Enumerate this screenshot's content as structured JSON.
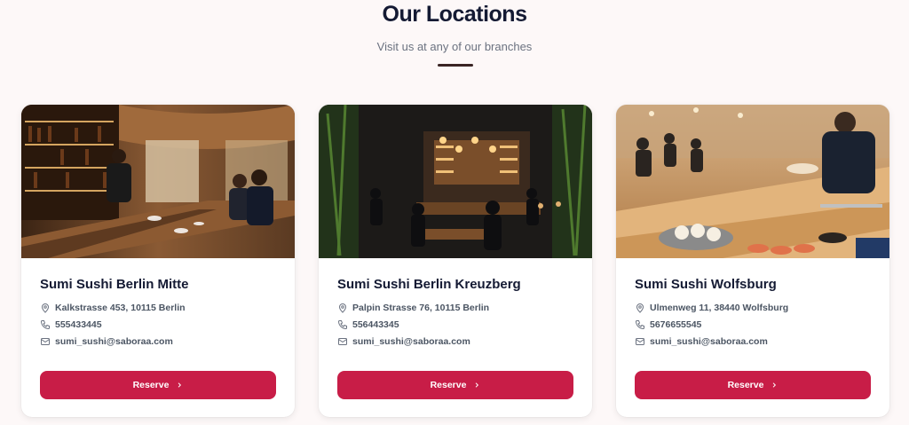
{
  "header": {
    "title": "Our Locations",
    "subtitle": "Visit us at any of our branches"
  },
  "colors": {
    "accent": "#c81d47",
    "title": "#141a33",
    "divider": "#3a2424",
    "background": "#fdf8f8"
  },
  "locations": [
    {
      "name": "Sumi Sushi Berlin Mitte",
      "address": "Kalkstrasse 453, 10115 Berlin",
      "phone": "555433445",
      "email": "sumi_sushi@saboraa.com",
      "button": "Reserve"
    },
    {
      "name": "Sumi Sushi Berlin Kreuzberg",
      "address": "Palpin Strasse 76, 10115 Berlin",
      "phone": "556443345",
      "email": "sumi_sushi@saboraa.com",
      "button": "Reserve"
    },
    {
      "name": "Sumi Sushi Wolfsburg",
      "address": "Ulmenweg 11, 38440 Wolfsburg",
      "phone": "5676655545",
      "email": "sumi_sushi@saboraa.com",
      "button": "Reserve"
    }
  ],
  "icons": {
    "address": "map-pin-icon",
    "phone": "phone-icon",
    "email": "mail-icon",
    "button": "chevron-right-icon"
  }
}
